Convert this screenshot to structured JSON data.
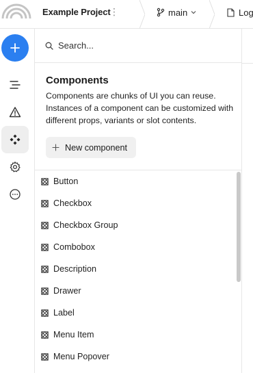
{
  "topbar": {
    "project_name": "Example Project",
    "project_menu_icon": "more-vertical-icon",
    "branch_label": "main",
    "branch_icon": "git-branch-icon",
    "log_tab_label": "Log",
    "log_tab_icon": "file-icon"
  },
  "rail": {
    "add_icon": "plus-icon",
    "items": [
      {
        "name": "layers",
        "icon": "list-icon"
      },
      {
        "name": "warnings",
        "icon": "warning-icon"
      },
      {
        "name": "components",
        "icon": "components-icon",
        "active": true
      },
      {
        "name": "settings",
        "icon": "gear-icon"
      },
      {
        "name": "more",
        "icon": "more-horizontal-icon"
      }
    ]
  },
  "search": {
    "placeholder": "Search..."
  },
  "components": {
    "title": "Components",
    "description": "Components are chunks of UI you can reuse. Instances of a component can be customized with different props, variants or slot contents.",
    "new_button_label": "New component",
    "items": [
      "Button",
      "Checkbox",
      "Checkbox Group",
      "Combobox",
      "Description",
      "Drawer",
      "Label",
      "Menu Item",
      "Menu Popover"
    ]
  },
  "colors": {
    "accent": "#2b7ff0",
    "active_bg": "#eeeeee",
    "border": "#e6e6e6",
    "button_bg": "#f0f0f0"
  }
}
